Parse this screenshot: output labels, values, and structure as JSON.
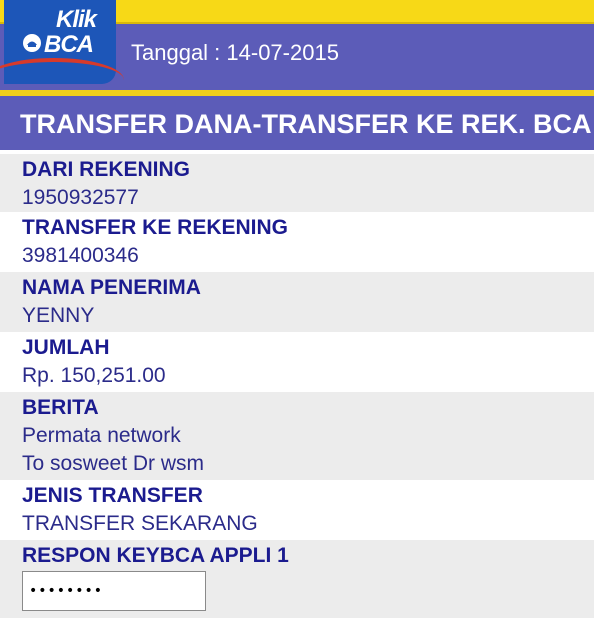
{
  "header": {
    "logo_text_top": "Klik",
    "logo_text_bottom": "BCA",
    "date_text": "Tanggal : 14-07-2015"
  },
  "title": "TRANSFER DANA-TRANSFER KE REK. BCA",
  "fields": [
    {
      "label": "DARI REKENING",
      "values": [
        "1950932577"
      ]
    },
    {
      "label": "TRANSFER KE REKENING",
      "values": [
        "3981400346"
      ]
    },
    {
      "label": "NAMA PENERIMA",
      "values": [
        "YENNY"
      ]
    },
    {
      "label": "JUMLAH",
      "values": [
        "Rp. 150,251.00"
      ]
    },
    {
      "label": "BERITA",
      "values": [
        "Permata network",
        "To sosweet Dr wsm"
      ]
    },
    {
      "label": "JENIS TRANSFER",
      "values": [
        "TRANSFER SEKARANG"
      ]
    }
  ],
  "respon": {
    "label": "RESPON KEYBCA APPLI 1",
    "input_value": "••••••••"
  },
  "colors": {
    "header_purple": "#5c5cb8",
    "header_yellow": "#f7d917",
    "logo_blue": "#1d56b8",
    "label_navy": "#1b1b8f",
    "row_gray": "#ececec"
  }
}
